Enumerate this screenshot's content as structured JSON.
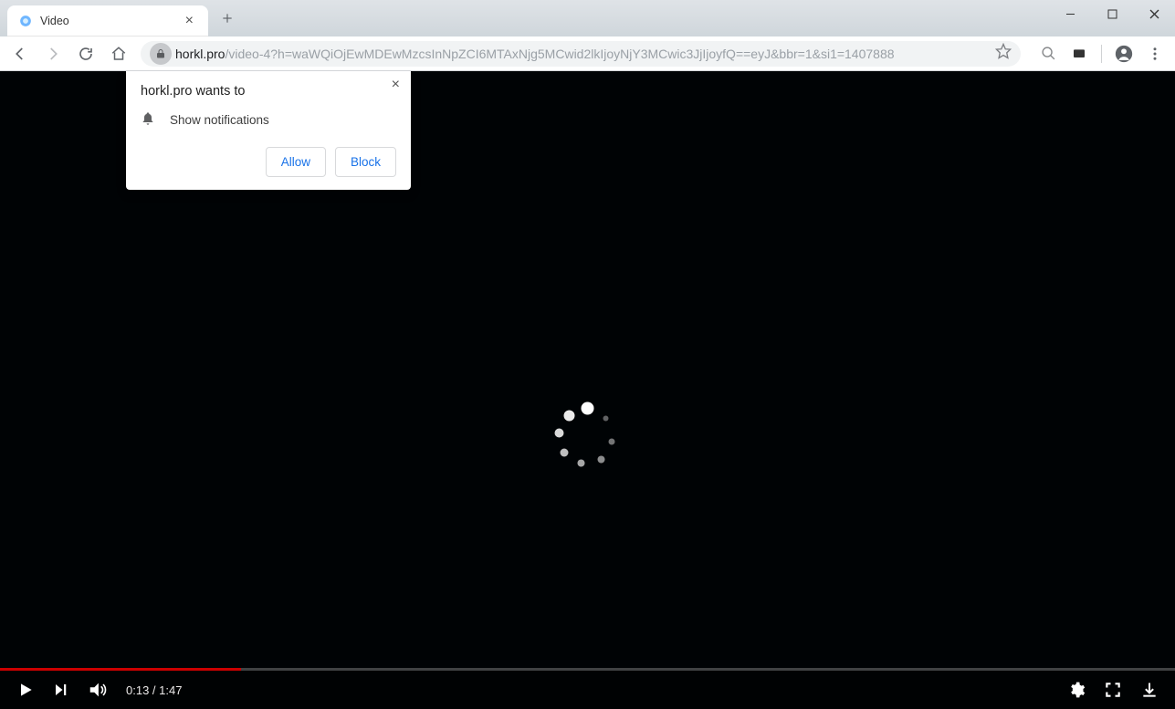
{
  "window": {
    "tab_title": "Video",
    "minimize_tip": "Minimize",
    "maximize_tip": "Maximize",
    "close_tip": "Close"
  },
  "toolbar": {
    "back_tip": "Back",
    "forward_tip": "Forward",
    "reload_tip": "Reload",
    "home_tip": "Home",
    "url_host": "horkl.pro",
    "url_path": "/video-4?h=waWQiOjEwMDEwMzcsInNpZCI6MTAxNjg5MCwid2lkIjoyNjY3MCwic3JjIjoyfQ==eyJ&bbr=1&si1=1407888",
    "star_tip": "Bookmark this page",
    "zoom_tip": "Zoom",
    "cast_tip": "Page tool",
    "profile_tip": "You",
    "menu_tip": "Customize and control"
  },
  "permission": {
    "title": "horkl.pro wants to",
    "request": "Show notifications",
    "allow_label": "Allow",
    "block_label": "Block",
    "close_tip": "Close"
  },
  "video": {
    "current_time": "0:13",
    "duration": "1:47",
    "separator": " / ",
    "progress_percent": 20.5,
    "play_tip": "Play",
    "next_tip": "Next",
    "volume_tip": "Mute",
    "settings_tip": "Settings",
    "fullscreen_tip": "Full screen",
    "download_tip": "Download"
  }
}
